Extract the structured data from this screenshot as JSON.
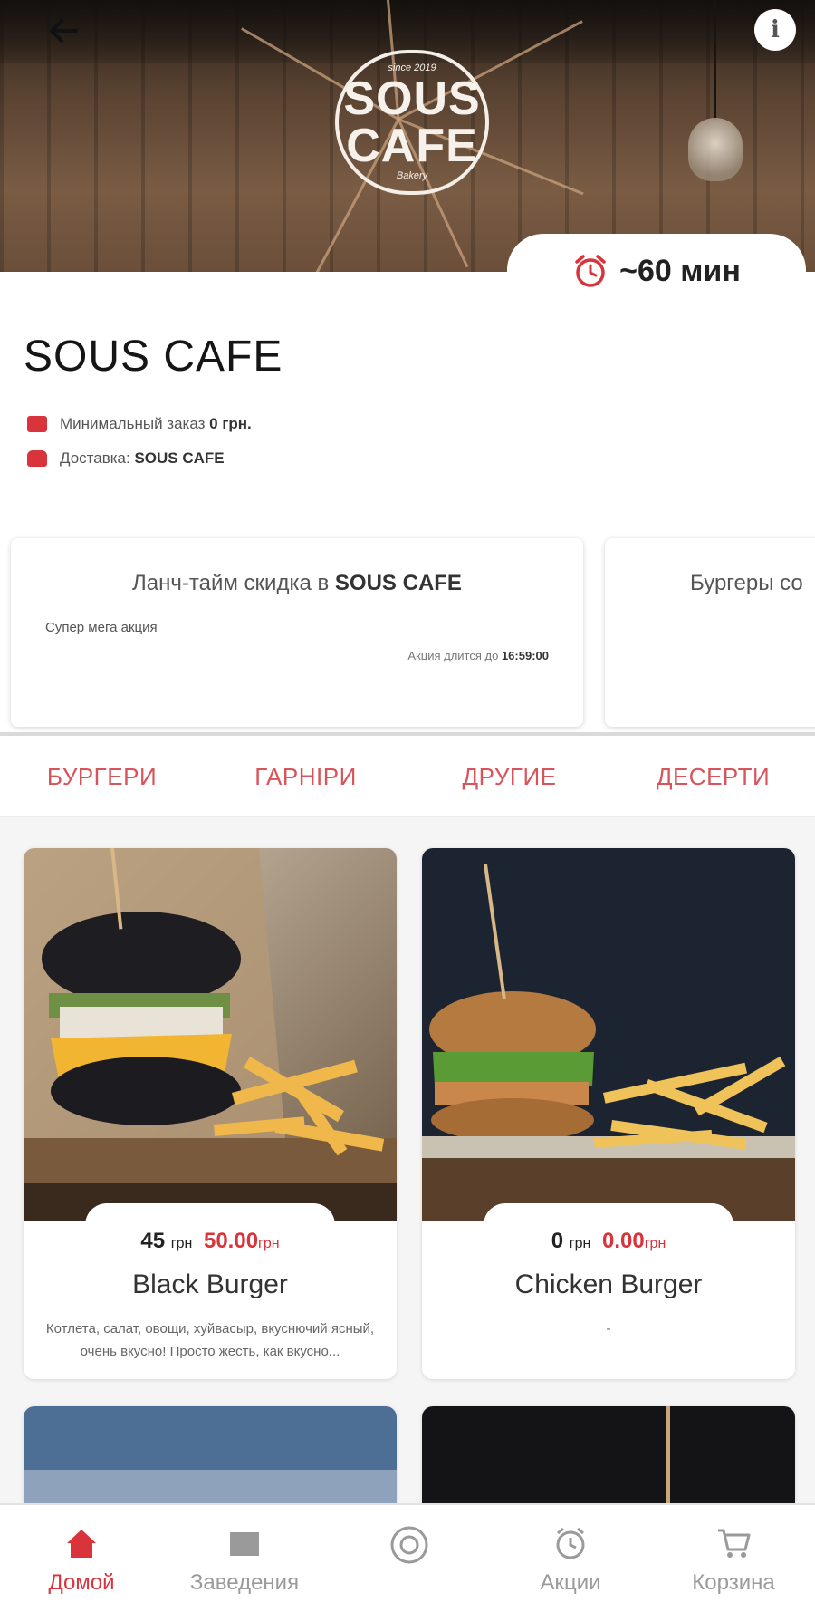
{
  "header": {
    "logo_line1": "SOUS",
    "logo_line2": "CAFE",
    "logo_small_top": "since 2019",
    "logo_small_bottom": "Bakery",
    "delivery_time": "~60 мин"
  },
  "restaurant": {
    "title": "SOUS CAFE",
    "min_order_label": "Минимальный заказ",
    "min_order_value": "0 грн.",
    "delivery_label": "Доставка:",
    "delivery_value": "SOUS CAFE"
  },
  "promos": [
    {
      "title_prefix": "Ланч-тайм скидка в",
      "title_venue": "SOUS CAFE",
      "description": "Супер мега акция",
      "date_label": "Акция длится до",
      "date_value": "16:59:00"
    },
    {
      "title_prefix": "Бургеры со",
      "title_venue": "",
      "description": "",
      "date_label": "",
      "date_value": ""
    }
  ],
  "tabs": [
    "БУРГЕРИ",
    "ГАРНІРИ",
    "ДРУГИЕ",
    "ДЕСЕРТИ"
  ],
  "products": [
    {
      "name": "Black Burger",
      "price": "45",
      "price_currency": "грн",
      "old_price": "50.00",
      "old_currency": "грн",
      "description": "Котлета, салат, овощи, хуйвасыр, вкуснючий ясный, очень вкусно! Просто жесть, как вкусно..."
    },
    {
      "name": "Chicken Burger",
      "price": "0",
      "price_currency": "грн",
      "old_price": "0.00",
      "old_currency": "грн",
      "description": "-"
    }
  ],
  "nav": [
    {
      "label": "Домой",
      "icon": "home-icon",
      "active": true
    },
    {
      "label": "Заведения",
      "icon": "store-icon",
      "active": false
    },
    {
      "label": "",
      "icon": "planet-icon",
      "active": false
    },
    {
      "label": "Акции",
      "icon": "promo-icon",
      "active": false
    },
    {
      "label": "Корзина",
      "icon": "cart-icon",
      "active": false
    }
  ],
  "colors": {
    "accent": "#d9343b",
    "tab_text": "#d9535a",
    "inactive_nav": "#9a9a9a"
  }
}
